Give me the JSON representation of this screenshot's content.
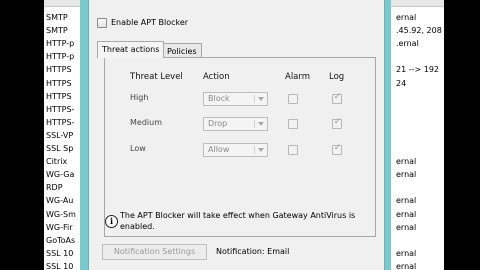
{
  "background_list": {
    "left_items": [
      "SMTP",
      "SMTP",
      "HTTP-p",
      "HTTP-p",
      "HTTPS",
      "HTTPS",
      "HTTPS",
      "HTTPS-",
      "HTTPS-",
      "SSL-VP",
      "SSL Sp",
      "Citrix",
      "WG-Ga",
      "RDP",
      "WG-Au",
      "WG-Sm",
      "WG-Fir",
      "GoToAs",
      "SSL 10",
      "SSL 10"
    ],
    "right_items": [
      "ernal",
      ".45.92, 208",
      ".ernal",
      "",
      "21 --> 192",
      "24",
      "",
      "",
      "",
      "",
      "",
      "ernal",
      "ernal",
      "",
      "ernal",
      "ernal",
      "ernal",
      "",
      "ernal",
      "ernal"
    ]
  },
  "dialog": {
    "enable_label": "Enable APT Blocker",
    "enable_checked": false,
    "tabs": [
      {
        "label": "Threat actions",
        "active": true
      },
      {
        "label": "Policies",
        "active": false
      }
    ],
    "table": {
      "headers": {
        "level": "Threat Level",
        "action": "Action",
        "alarm": "Alarm",
        "log": "Log"
      },
      "rows": [
        {
          "level": "High",
          "action": "Block",
          "alarm": false,
          "log": true
        },
        {
          "level": "Medium",
          "action": "Drop",
          "alarm": false,
          "log": true
        },
        {
          "level": "Low",
          "action": "Allow",
          "alarm": false,
          "log": true
        }
      ]
    },
    "info_text_line1": "The APT Blocker will take effect when Gateway AntiVirus is",
    "info_text_line2": "enabled.",
    "notification_button": "Notification Settings",
    "notification_status": "Notification: Email"
  }
}
